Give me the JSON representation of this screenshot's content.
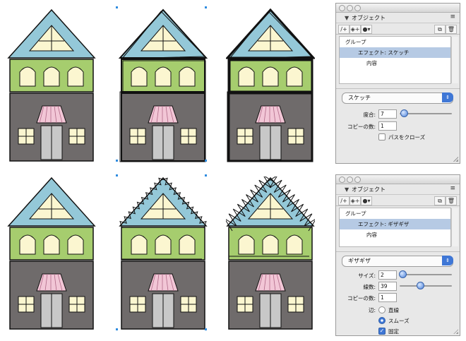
{
  "panels": [
    {
      "title": "オブジェクト",
      "items": [
        {
          "label": "グループ",
          "indent": 8,
          "selected": false
        },
        {
          "label": "エフェクト: スケッチ",
          "indent": 26,
          "selected": true
        },
        {
          "label": "内容",
          "indent": 38,
          "selected": false
        }
      ],
      "dropdown": "スケッチ",
      "fields": [
        {
          "label": "度合:",
          "value": "7",
          "slider": 0.05
        },
        {
          "label": "コピーの数:",
          "value": "1"
        }
      ],
      "checkbox": {
        "label": "パスをクローズ",
        "checked": false
      }
    },
    {
      "title": "オブジェクト",
      "items": [
        {
          "label": "グループ",
          "indent": 8,
          "selected": false
        },
        {
          "label": "エフェクト: ギザギザ",
          "indent": 26,
          "selected": true
        },
        {
          "label": "内容",
          "indent": 38,
          "selected": false
        }
      ],
      "dropdown": "ギザギザ",
      "fields": [
        {
          "label": "サイズ:",
          "value": "2",
          "slider": 0.02
        },
        {
          "label": "線数:",
          "value": "39",
          "slider": 0.38
        },
        {
          "label": "コピーの数:",
          "value": "1"
        }
      ],
      "edge": {
        "label": "辺:",
        "options": [
          "直線",
          "スムーズ"
        ],
        "selected": 1
      },
      "checkbox": {
        "label": "固定",
        "checked": true
      }
    }
  ],
  "colors": {
    "roof_blue": "#94c8d8",
    "wall_green": "#a6cd6e",
    "base_gray": "#6f6b6b",
    "window_cream": "#fbf6d0",
    "awning_pink": "#f2c6d6",
    "door_gray": "#c8c8c8"
  },
  "houses": [
    {
      "row": 0,
      "col": 0,
      "style": "plain"
    },
    {
      "row": 0,
      "col": 1,
      "style": "sketch"
    },
    {
      "row": 0,
      "col": 2,
      "style": "sketch-heavy"
    },
    {
      "row": 1,
      "col": 0,
      "style": "plain"
    },
    {
      "row": 1,
      "col": 1,
      "style": "zigzag"
    },
    {
      "row": 1,
      "col": 2,
      "style": "spiky"
    }
  ]
}
